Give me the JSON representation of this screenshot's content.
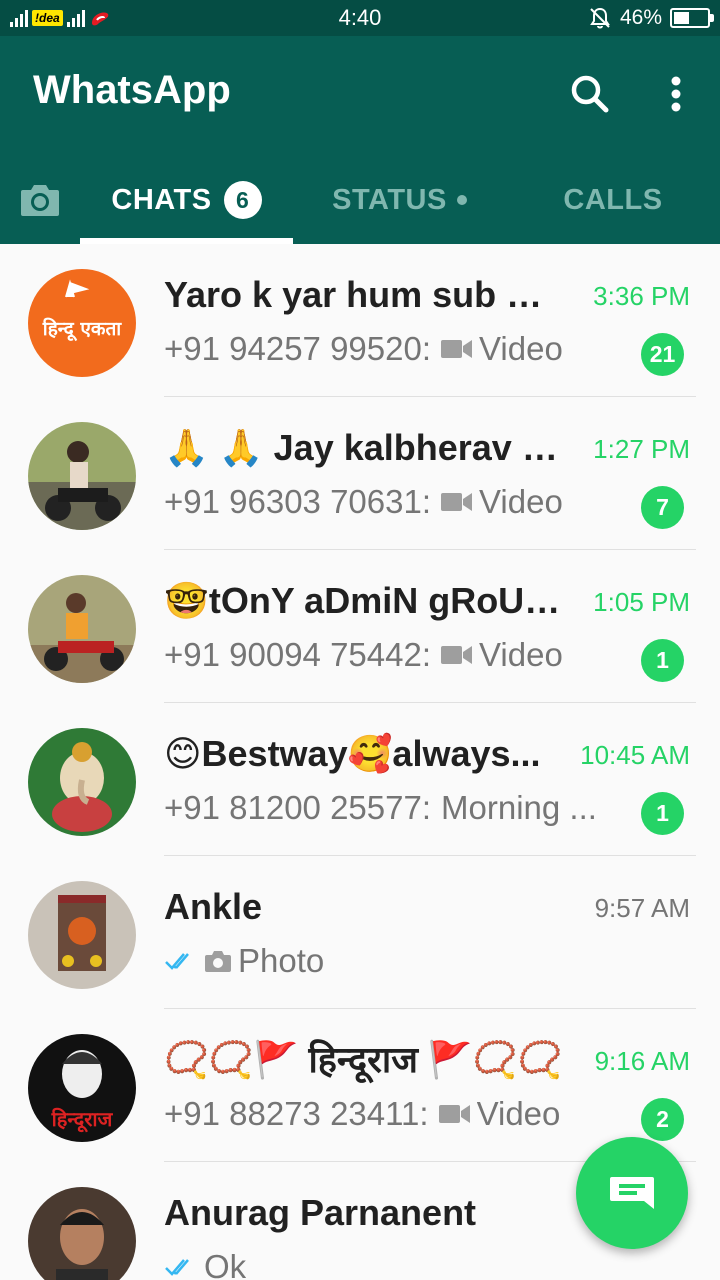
{
  "status_bar": {
    "carrier": "!dea",
    "time": "4:40",
    "battery_percent": "46%",
    "battery_level": 0.46
  },
  "app": {
    "title": "WhatsApp"
  },
  "tabs": {
    "chats_label": "CHATS",
    "chats_badge": "6",
    "status_label": "STATUS",
    "calls_label": "CALLS"
  },
  "chats": [
    {
      "name": "Yaro k yar hum sub 👳🏼‍♂️...",
      "time": "3:36 PM",
      "sender": "+91 94257 99520:",
      "media": "video-icon",
      "message": "Video",
      "unread": "21"
    },
    {
      "name": "🙏 🙏 Jay kalbherav 🙏...",
      "time": "1:27 PM",
      "sender": "+91 96303 70631:",
      "media": "video-icon",
      "message": "Video",
      "unread": "7"
    },
    {
      "name": "🤓tOnY aDmiN gRoUp...",
      "time": "1:05 PM",
      "sender": "+91 90094 75442:",
      "media": "video-icon",
      "message": "Video",
      "unread": "1"
    },
    {
      "name": "😊Bestway🥰always...",
      "time": "10:45 AM",
      "sender": "+91 81200 25577:",
      "media": "",
      "message": "Morning ...",
      "unread": "1"
    },
    {
      "name": "Ankle",
      "time": "9:57 AM",
      "sender": "",
      "media": "camera-icon",
      "message": "Photo",
      "unread": ""
    },
    {
      "name": "📿📿🚩 हिन्दूराज 🚩📿📿",
      "time": "9:16 AM",
      "sender": "+91 88273 23411:",
      "media": "video-icon",
      "message": "Video",
      "unread": "2"
    },
    {
      "name": "Anurag Parnanent",
      "time": "",
      "sender": "",
      "media": "",
      "message": "Ok",
      "unread": ""
    }
  ],
  "avatar_labels": {
    "hindu_ekta": "हिन्दू एकता",
    "hindu_raj": "हिन्दूराज"
  },
  "colors": {
    "header": "#075e54",
    "statusbar": "#054d44",
    "accent": "#25d366",
    "read_ticks": "#34b7f1"
  }
}
